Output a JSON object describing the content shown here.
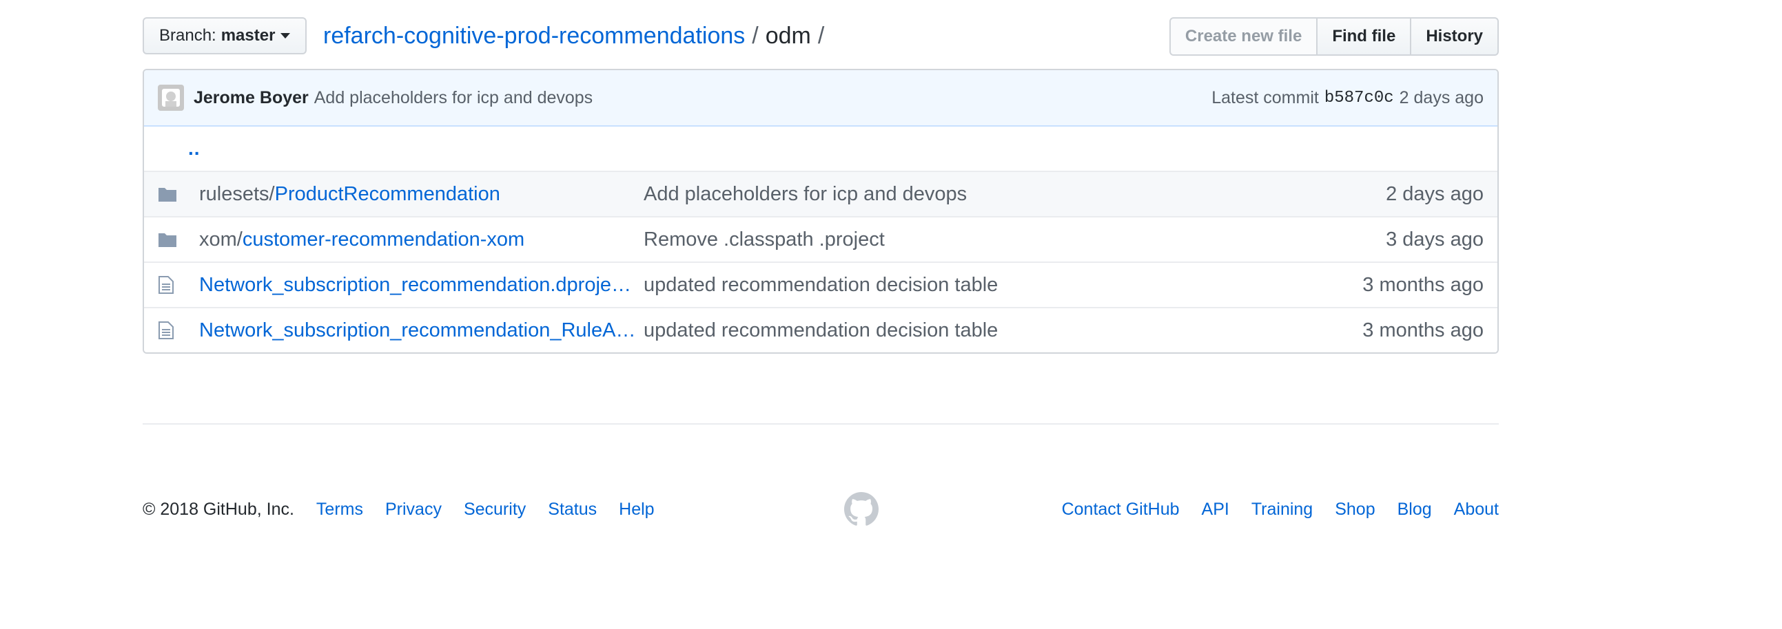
{
  "branch": {
    "label": "Branch:",
    "value": "master"
  },
  "breadcrumb": {
    "repo": "refarch-cognitive-prod-recommendations",
    "separator": "/",
    "current": "odm",
    "trailing": "/"
  },
  "actions": {
    "create_new_file": "Create new file",
    "find_file": "Find file",
    "history": "History"
  },
  "commit": {
    "author": "Jerome Boyer",
    "message": "Add placeholders for icp and devops",
    "latest_label": "Latest commit",
    "sha": "b587c0c",
    "age": "2 days ago"
  },
  "updir": "..",
  "files": [
    {
      "type": "folder",
      "prefix": "rulesets/",
      "name": "ProductRecommendation",
      "message": "Add placeholders for icp and devops",
      "age": "2 days ago"
    },
    {
      "type": "folder",
      "prefix": "xom/",
      "name": "customer-recommendation-xom",
      "message": "Remove .classpath .project",
      "age": "3 days ago"
    },
    {
      "type": "file",
      "prefix": "",
      "name": "Network_subscription_recommendation.dproje…",
      "message": "updated recommendation decision table",
      "age": "3 months ago"
    },
    {
      "type": "file",
      "prefix": "",
      "name": "Network_subscription_recommendation_RuleA…",
      "message": "updated recommendation decision table",
      "age": "3 months ago"
    }
  ],
  "footer": {
    "copyright": "© 2018 GitHub, Inc.",
    "left_links": [
      "Terms",
      "Privacy",
      "Security",
      "Status",
      "Help"
    ],
    "right_links": [
      "Contact GitHub",
      "API",
      "Training",
      "Shop",
      "Blog",
      "About"
    ]
  },
  "icons": {
    "folder": "folder-icon",
    "file": "file-icon",
    "logo": "github-mark-icon",
    "avatar": "avatar-icon",
    "caret": "caret-down-icon"
  },
  "colors": {
    "link": "#0366d6",
    "muted": "#586069",
    "icon": "#8a9bb0",
    "commit_bg": "#f1f8ff",
    "border": "#d1d5da"
  }
}
